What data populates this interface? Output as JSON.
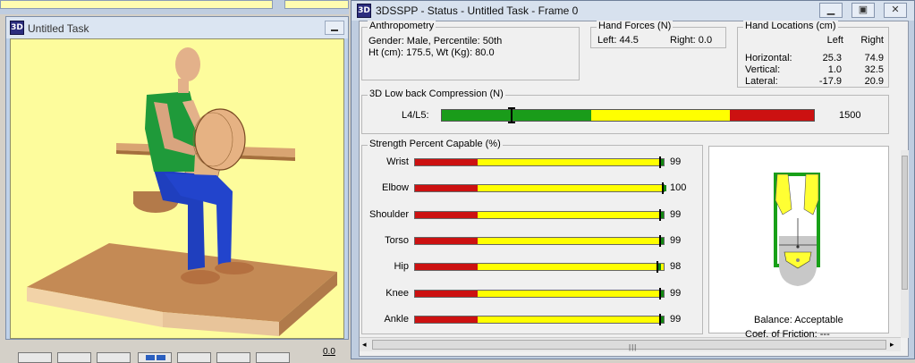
{
  "colors": {
    "viewport_bg": "#fdfc9c",
    "bar_green": "#1a9c1a",
    "bar_yellow": "#ffff00",
    "bar_red": "#cc1111"
  },
  "task_window": {
    "icon_text": "3D",
    "title": "Untitled Task",
    "frame_value": "0.0"
  },
  "status_window": {
    "icon_text": "3D",
    "title": "3DSSPP - Status - Untitled Task - Frame 0",
    "controls": [
      "minimize-icon",
      "restore-icon",
      "close-icon"
    ]
  },
  "anthropometry": {
    "label": "Anthropometry",
    "line1": "Gender: Male, Percentile: 50th",
    "line2": "Ht (cm): 175.5, Wt (Kg): 80.0"
  },
  "hand_forces": {
    "label": "Hand Forces (N)",
    "left": "Left:  44.5",
    "right": "Right:  0.0"
  },
  "hand_locations": {
    "label": "Hand Locations (cm)",
    "col_left": "Left",
    "col_right": "Right",
    "rows": [
      {
        "name": "Horizontal:",
        "left": "25.3",
        "right": "74.9"
      },
      {
        "name": "Vertical:",
        "left": "1.0",
        "right": "32.5"
      },
      {
        "name": "Lateral:",
        "left": "-17.9",
        "right": "20.9"
      }
    ]
  },
  "compression": {
    "label": "3D Low back Compression (N)",
    "row_label": "L4/L5:",
    "value": "1500",
    "value_num": 1500,
    "zones": [
      0.4,
      0.77
    ]
  },
  "strength": {
    "label": "Strength Percent Capable (%)",
    "rows": [
      {
        "name": "Wrist",
        "value": "99",
        "pct": 99
      },
      {
        "name": "Elbow",
        "value": "100",
        "pct": 100
      },
      {
        "name": "Shoulder",
        "value": "99",
        "pct": 99
      },
      {
        "name": "Torso",
        "value": "99",
        "pct": 99
      },
      {
        "name": "Hip",
        "value": "98",
        "pct": 98
      },
      {
        "name": "Knee",
        "value": "99",
        "pct": 99
      },
      {
        "name": "Ankle",
        "value": "99",
        "pct": 99
      }
    ]
  },
  "balance": {
    "status": "Balance: Acceptable",
    "friction": "Coef. of Friction:  ---"
  }
}
